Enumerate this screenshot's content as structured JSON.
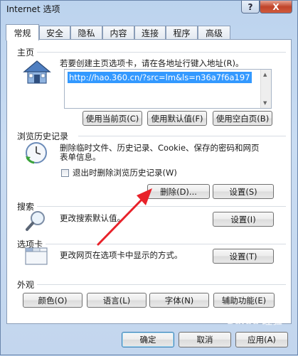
{
  "window": {
    "title": "Internet 选项",
    "help_label": "?",
    "close_label": "X"
  },
  "tabs": [
    {
      "label": "常规",
      "active": true
    },
    {
      "label": "安全"
    },
    {
      "label": "隐私"
    },
    {
      "label": "内容"
    },
    {
      "label": "连接"
    },
    {
      "label": "程序"
    },
    {
      "label": "高级"
    }
  ],
  "home": {
    "heading": "主页",
    "description": "若要创建主页选项卡，请在各地址行键入地址(R)。",
    "url": "http://hao.360.cn/?src=lm&ls=n36a7f6a197",
    "btn_current": "使用当前页(C)",
    "btn_default": "使用默认值(F)",
    "btn_blank": "使用空白页(B)"
  },
  "history": {
    "heading": "浏览历史记录",
    "description_1": "删除临时文件、历史记录、Cookie、保存的密码和网页",
    "description_2": "表单信息。",
    "checkbox_label": "退出时删除浏览历史记录(W)",
    "checkbox_checked": false,
    "btn_delete": "删除(D)...",
    "btn_settings": "设置(S)"
  },
  "search": {
    "heading": "搜索",
    "description": "更改搜索默认值。",
    "btn_settings": "设置(I)"
  },
  "tabs_section": {
    "heading": "选项卡",
    "description": "更改网页在选项卡中显示的方式。",
    "btn_settings": "设置(T)"
  },
  "appearance": {
    "heading": "外观",
    "btn_colors": "颜色(O)",
    "btn_languages": "语言(L)",
    "btn_fonts": "字体(N)",
    "btn_accessibility": "辅助功能(E)"
  },
  "footer": {
    "ok": "确定",
    "cancel": "取消",
    "apply": "应用(A)"
  },
  "watermark": "Baidu 经验",
  "annotation_arrow_color": "#e8222a"
}
